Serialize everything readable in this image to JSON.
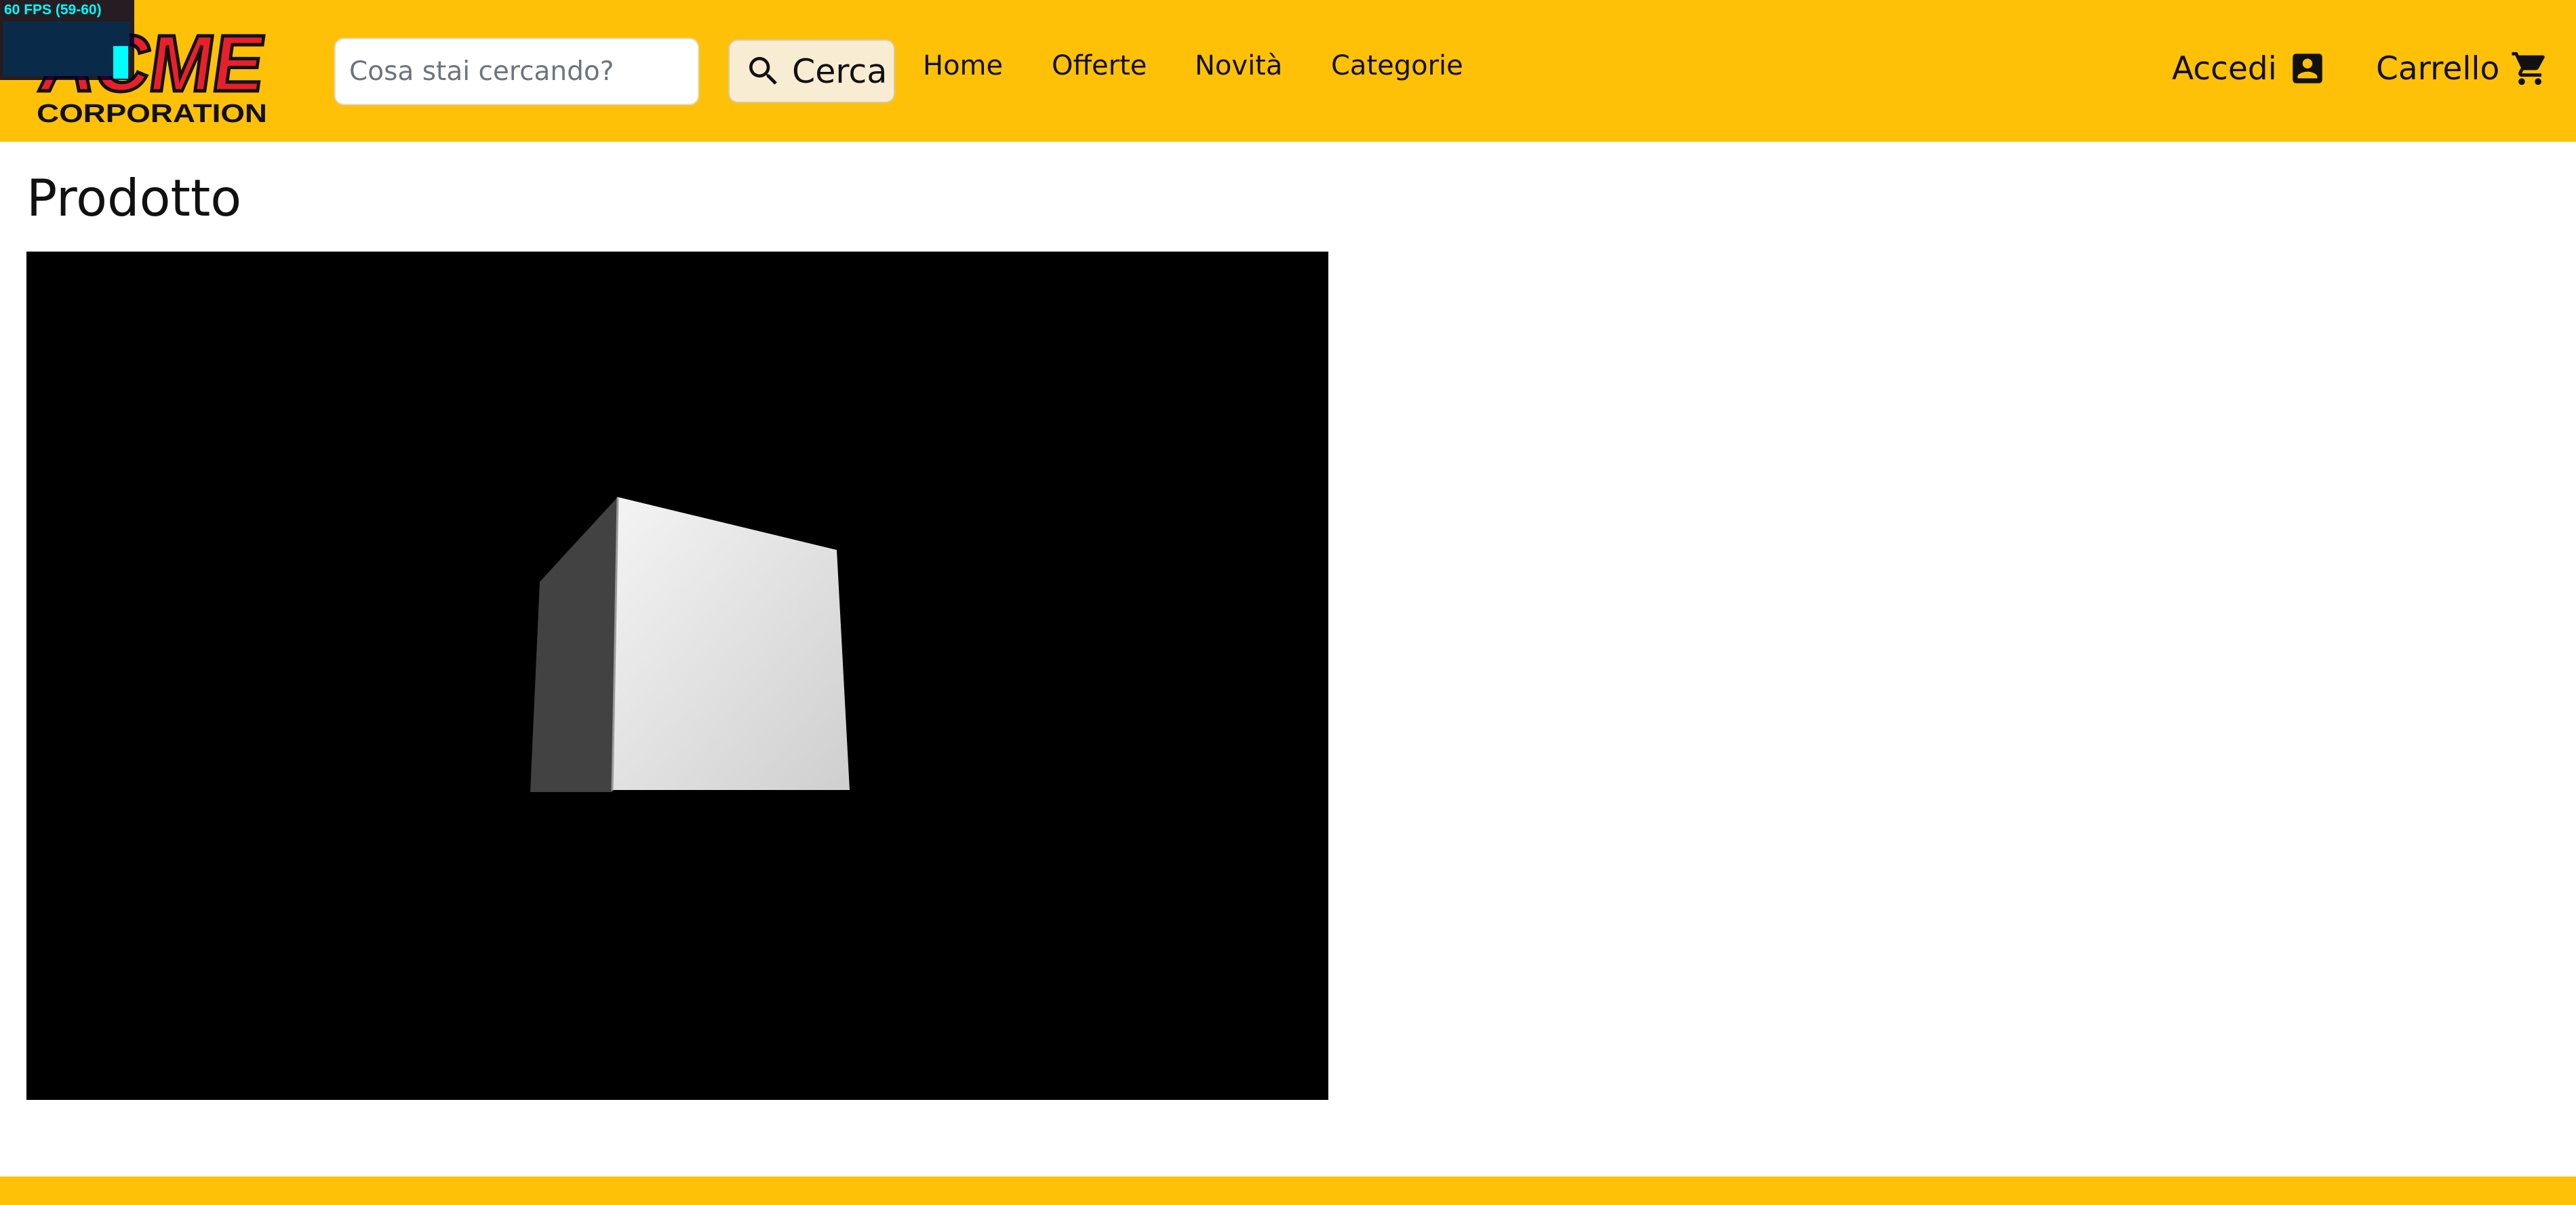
{
  "fps_meter": {
    "text": "60 FPS (59-60)"
  },
  "header": {
    "logo": {
      "word": "ACME",
      "subtitle": "CORPORATION"
    },
    "search": {
      "placeholder": "Cosa stai cercando?",
      "value": "",
      "button_label": "Cerca",
      "icon": "search-icon"
    },
    "nav": [
      {
        "label": "Home"
      },
      {
        "label": "Offerte"
      },
      {
        "label": "Novità"
      },
      {
        "label": "Categorie"
      }
    ],
    "account": {
      "label": "Accedi",
      "icon": "account-box-icon"
    },
    "cart": {
      "label": "Carrello",
      "icon": "shopping-cart-icon"
    }
  },
  "main": {
    "title": "Prodotto",
    "viewer": {
      "object": "cube"
    }
  },
  "colors": {
    "brand_yellow": "#ffc107",
    "logo_red": "#e8202a",
    "viewer_background": "#000000",
    "text": "#111111"
  }
}
